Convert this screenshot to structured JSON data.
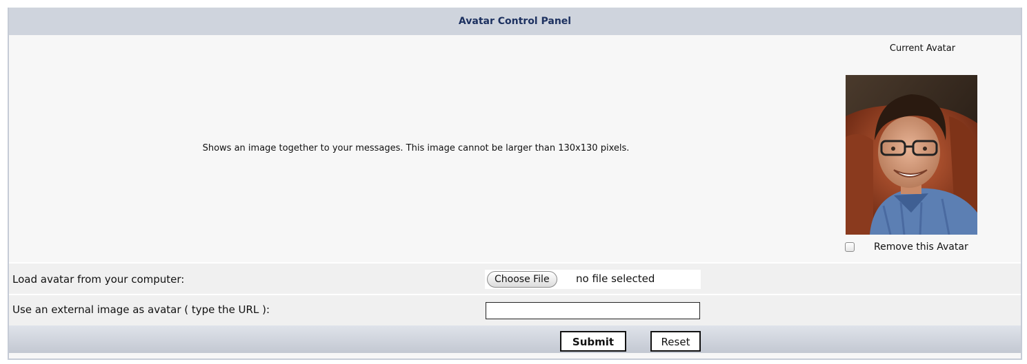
{
  "panel": {
    "title": "Avatar Control Panel",
    "description": "Shows an image together to your messages. This image cannot be larger than 130x130 pixels.",
    "current_avatar_label": "Current Avatar",
    "remove_avatar_label": "Remove this Avatar",
    "remove_avatar_checked": false
  },
  "form": {
    "load_label": "Load avatar from your computer:",
    "choose_file_label": "Choose File",
    "no_file_text": "no file selected",
    "url_label": "Use an external image as avatar ( type the URL ):",
    "url_value": ""
  },
  "footer": {
    "submit_label": "Submit",
    "reset_label": "Reset"
  },
  "colors": {
    "header_bg": "#cfd4dd",
    "header_text": "#1d3160",
    "row_bg": "#f0f0f0"
  }
}
